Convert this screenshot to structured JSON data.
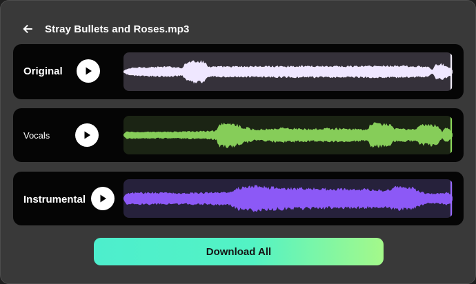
{
  "header": {
    "back_icon": "arrow-left-icon",
    "title": "Stray Bullets and Roses.mp3"
  },
  "tracks": [
    {
      "label": "Original",
      "play_icon": "play-icon",
      "wave_color": "#efe7ff",
      "wave_bg": "#35313a",
      "playhead_color": "#f0ecf7",
      "playback_progress": 1.0
    },
    {
      "label": "Vocals",
      "play_icon": "play-icon",
      "wave_color": "#86cd59",
      "wave_bg": "#1b2414",
      "playhead_color": "#8edc5c",
      "playback_progress": 1.0
    },
    {
      "label": "Instrumental",
      "play_icon": "play-icon",
      "wave_color": "#8c59f6",
      "wave_bg": "#26213b",
      "playhead_color": "#9a6bff",
      "playback_progress": 1.0
    }
  ],
  "download": {
    "label": "Download All"
  }
}
